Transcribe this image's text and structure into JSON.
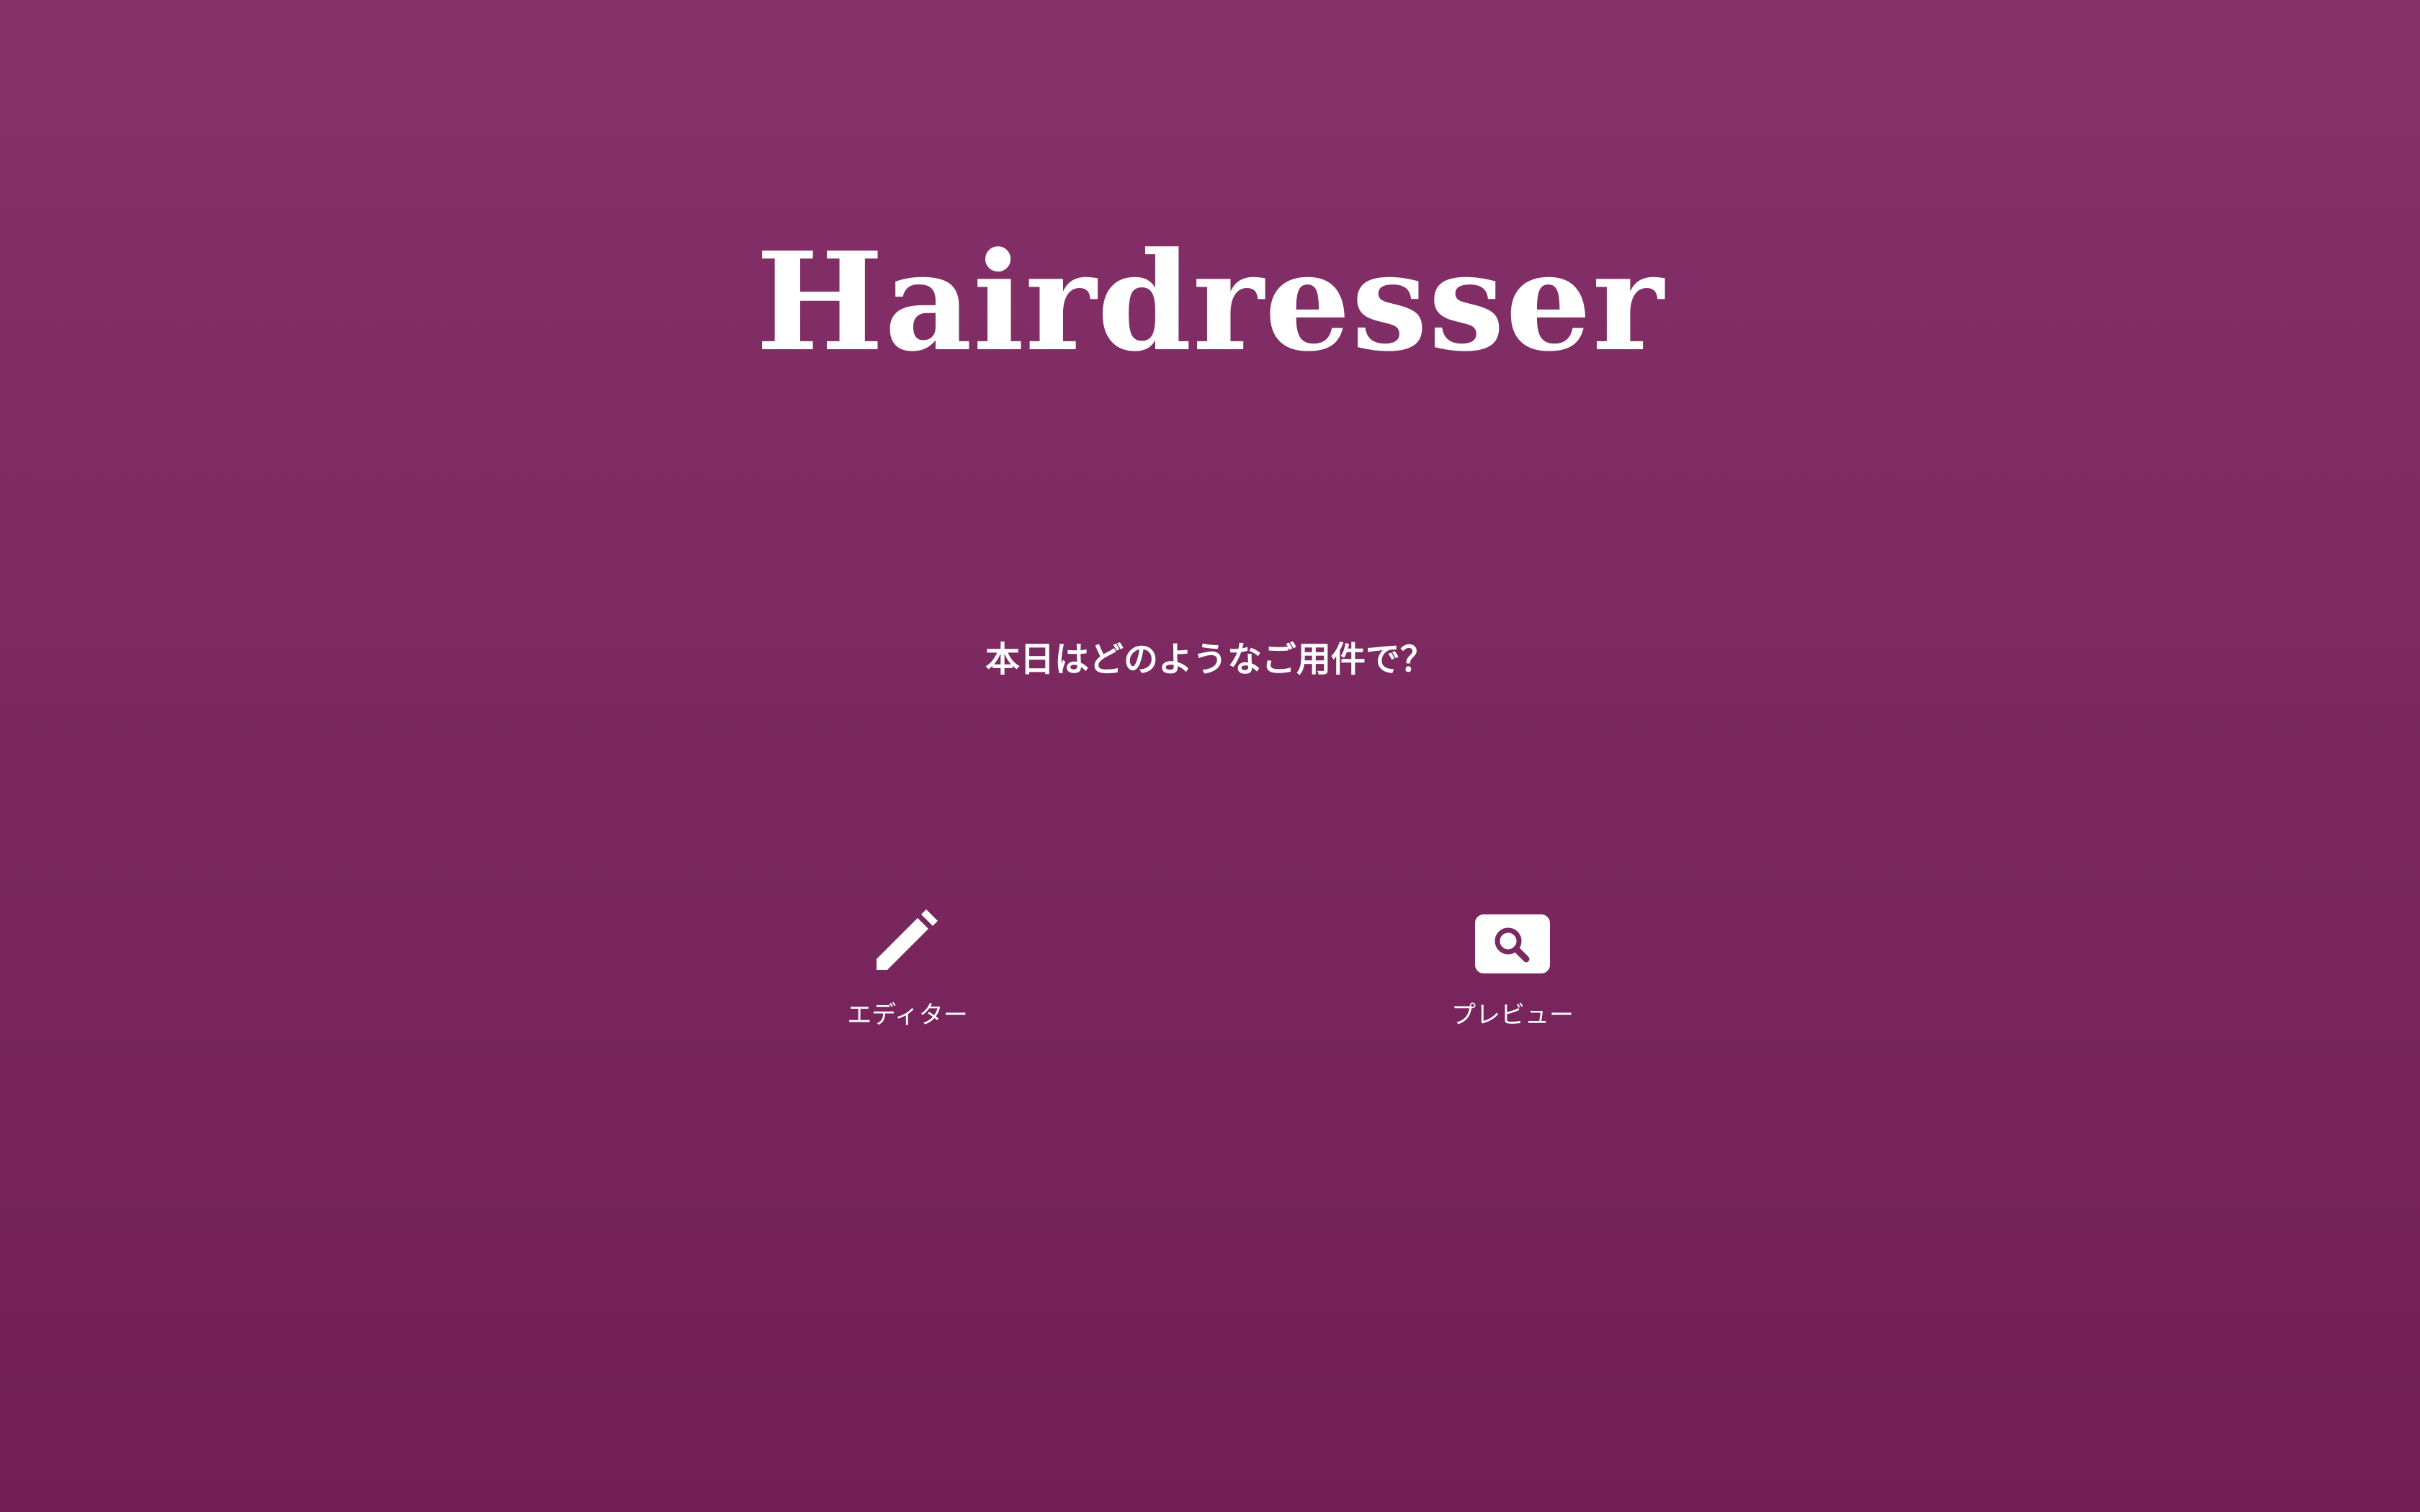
{
  "app": {
    "title": "Hairdresser",
    "background_top": "#87316a",
    "background_bottom": "#711f56",
    "text_color": "#ffffff"
  },
  "prompt": {
    "question": "本日はどのようなご用件で？"
  },
  "actions": [
    {
      "label": "エディター",
      "icon": "pencil-icon"
    },
    {
      "label": "プレビュー",
      "icon": "preview-search-icon"
    }
  ]
}
